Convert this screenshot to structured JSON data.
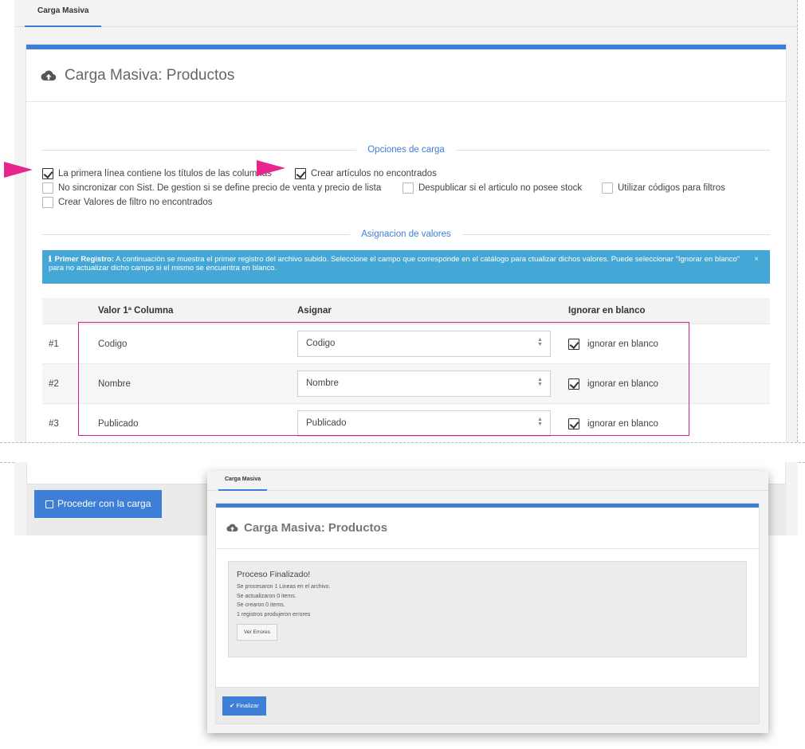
{
  "tab": {
    "label": "Carga Masiva"
  },
  "card": {
    "title": "Carga Masiva: Productos"
  },
  "sections": {
    "load_options": "Opciones de carga",
    "value_assignment": "Asignacion de valores"
  },
  "options": {
    "first_line_titles": {
      "label": "La primera línea contiene los títulos de las columnas",
      "checked": true
    },
    "create_missing_items": {
      "label": "Crear artículos no encontrados",
      "checked": true
    },
    "no_sync": {
      "label": "No sincronizar con Sist. De gestion si se define precio de venta y precio de lista",
      "checked": false
    },
    "unpublish_no_stock": {
      "label": "Despublicar si el articulo no posee stock",
      "checked": false
    },
    "use_codes_filters": {
      "label": "Utilizar códigos para filtros",
      "checked": false
    },
    "create_filter_values": {
      "label": "Crear Valores de filtro no encontrados",
      "checked": false
    }
  },
  "info": {
    "icon": "info-icon",
    "bold": "Primer Registro:",
    "text": " A continuación se muestra el primer registro del archivo subido. Seleccione el campo que corresponde en el catálogo para ctualizar dichos valores. Puede seleccionar \"Ignorar en blanco\" para no actualizar dicho campo si el mismo se encuentra en blanco.",
    "close": "×"
  },
  "table": {
    "headers": {
      "value": "Valor 1ª Columna",
      "assign": "Asignar",
      "ignore": "Ignorar en blanco"
    },
    "rows": [
      {
        "num": "#1",
        "value": "Codigo",
        "assign": "Codigo",
        "ignore_label": "ignorar en blanco",
        "ignore_checked": true
      },
      {
        "num": "#2",
        "value": "Nombre",
        "assign": "Nombre",
        "ignore_label": "ignorar en blanco",
        "ignore_checked": true
      },
      {
        "num": "#3",
        "value": "Publicado",
        "assign": "Publicado",
        "ignore_label": "ignorar en blanco",
        "ignore_checked": true
      }
    ]
  },
  "actions": {
    "proceed": "Proceder con la carga"
  },
  "overlay": {
    "tab": "Carga Masiva",
    "title": "Carga Masiva: Productos",
    "result": {
      "title": "Proceso Finalizado!",
      "lines": [
        "Se procesaron 1 Lineas en el archivo.",
        "Se actualizaron 0 items.",
        "Se crearon 0 items.",
        "1 registros produjeron errores"
      ],
      "errors_button": "Ver Errores"
    },
    "finish_button": "Finalizar"
  },
  "colors": {
    "accent": "#3d7fd6",
    "info_bg": "#45a7d6",
    "highlight": "#e8248f"
  }
}
